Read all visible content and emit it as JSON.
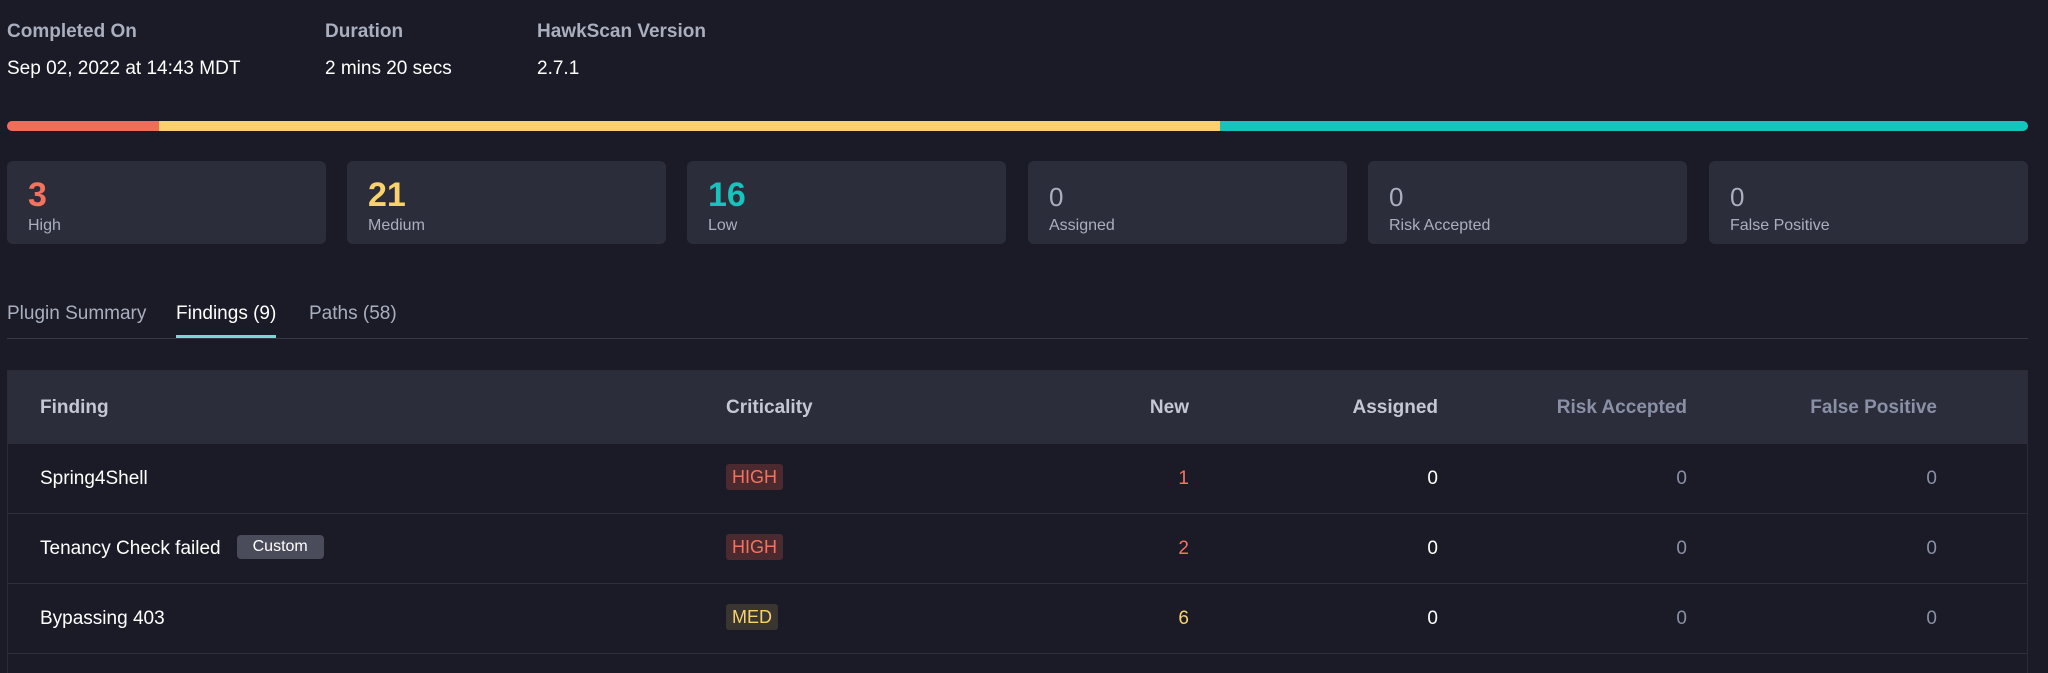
{
  "meta": {
    "completed_on": {
      "label": "Completed On",
      "value": "Sep 02, 2022 at 14:43 MDT"
    },
    "duration": {
      "label": "Duration",
      "value": "2 mins 20 secs"
    },
    "version": {
      "label": "HawkScan Version",
      "value": "2.7.1"
    }
  },
  "progress": {
    "high_fraction": 0.075,
    "medium_fraction": 0.525,
    "low_fraction": 0.4,
    "colors": {
      "high": "#f26c5b",
      "medium": "#f8d36b",
      "low": "#16c3bd"
    }
  },
  "stats": [
    {
      "value": "3",
      "label": "High"
    },
    {
      "value": "21",
      "label": "Medium"
    },
    {
      "value": "16",
      "label": "Low"
    },
    {
      "value": "0",
      "label": "Assigned"
    },
    {
      "value": "0",
      "label": "Risk Accepted"
    },
    {
      "value": "0",
      "label": "False Positive"
    }
  ],
  "tabs": [
    {
      "label": "Plugin Summary",
      "active": false
    },
    {
      "label": "Findings (9)",
      "active": true
    },
    {
      "label": "Paths (58)",
      "active": false
    }
  ],
  "table": {
    "headers": {
      "finding": "Finding",
      "criticality": "Criticality",
      "new": "New",
      "assigned": "Assigned",
      "risk_accepted": "Risk Accepted",
      "false_positive": "False Positive"
    },
    "rows": [
      {
        "finding": "Spring4Shell",
        "badge": "",
        "criticality": "HIGH",
        "new": "1",
        "assigned": "0",
        "risk_accepted": "0",
        "false_positive": "0"
      },
      {
        "finding": "Tenancy Check failed",
        "badge": "Custom",
        "criticality": "HIGH",
        "new": "2",
        "assigned": "0",
        "risk_accepted": "0",
        "false_positive": "0"
      },
      {
        "finding": "Bypassing 403",
        "badge": "",
        "criticality": "MED",
        "new": "6",
        "assigned": "0",
        "risk_accepted": "0",
        "false_positive": "0"
      }
    ]
  }
}
